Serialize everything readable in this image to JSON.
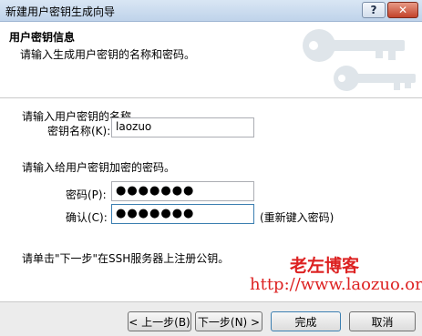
{
  "window": {
    "title": "新建用户密钥生成向导",
    "help_label": "?",
    "close_label": "✕"
  },
  "header": {
    "title": "用户密钥信息",
    "subtitle": "请输入生成用户密钥的名称和密码。"
  },
  "name_section": {
    "prompt": "请输入用户密钥的名称。",
    "label": "密钥名称(K):",
    "value": "laozuo"
  },
  "password_section": {
    "prompt": "请输入给用户密钥加密的密码。",
    "password_label": "密码(P):",
    "password_value": "●●●●●●●",
    "confirm_label": "确认(C):",
    "confirm_value": "●●●●●●●",
    "confirm_hint": "(重新键入密码)"
  },
  "instruction": "请单击\"下一步\"在SSH服务器上注册公钥。",
  "watermark": {
    "name": "老左博客",
    "url": "http://www.laozuo.org"
  },
  "buttons": {
    "back": "< 上一步(B)",
    "next": "下一步(N) >",
    "finish": "完成",
    "cancel": "取消"
  }
}
